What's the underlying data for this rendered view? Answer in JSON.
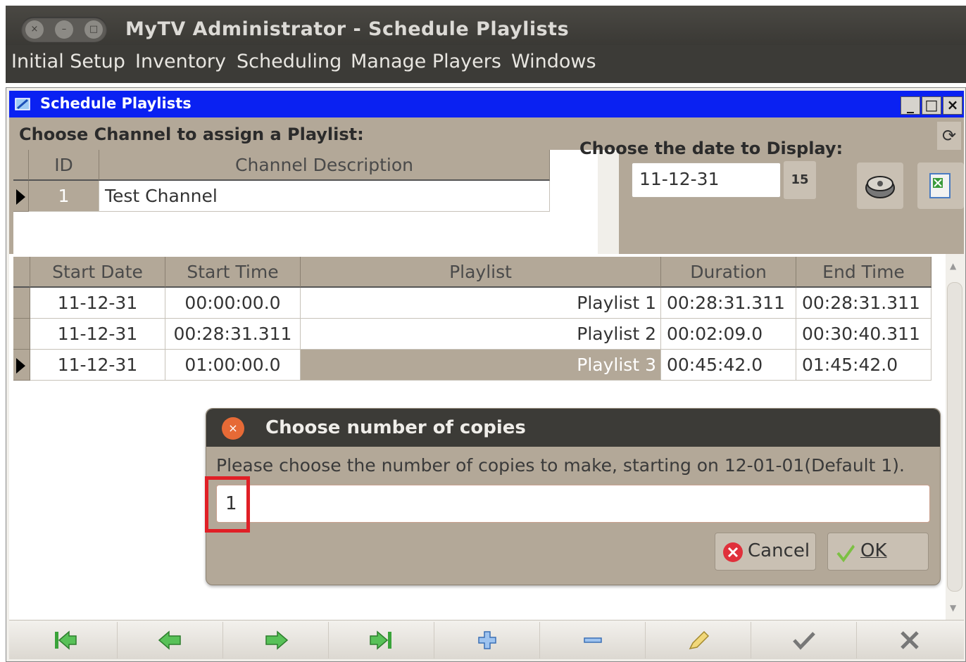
{
  "app": {
    "title": "MyTV Administrator - Schedule Playlists"
  },
  "menu": {
    "items": [
      "Initial Setup",
      "Inventory",
      "Scheduling",
      "Manage Players",
      "Windows"
    ]
  },
  "inner_window": {
    "title": "Schedule Playlists"
  },
  "channel_panel": {
    "label": "Choose Channel to assign a Playlist:",
    "columns": [
      "ID",
      "Channel Description"
    ],
    "rows": [
      {
        "id": "1",
        "description": "Test Channel"
      }
    ]
  },
  "date_panel": {
    "label": "Choose the date to Display:",
    "date_value": "11-12-31",
    "calendar_button_label": "15"
  },
  "schedule": {
    "columns": [
      "Start Date",
      "Start Time",
      "Playlist",
      "Duration",
      "End Time"
    ],
    "rows": [
      {
        "start_date": "11-12-31",
        "start_time": "00:00:00.0",
        "playlist": "Playlist 1",
        "duration": "00:28:31.311",
        "end_time": "00:28:31.311"
      },
      {
        "start_date": "11-12-31",
        "start_time": "00:28:31.311",
        "playlist": "Playlist 2",
        "duration": "00:02:09.0",
        "end_time": "00:30:40.311"
      },
      {
        "start_date": "11-12-31",
        "start_time": "01:00:00.0",
        "playlist": "Playlist 3",
        "duration": "00:45:42.0",
        "end_time": "01:45:42.0"
      }
    ]
  },
  "dialog": {
    "title": "Choose number of copies",
    "message": "Please choose the number of copies to make, starting on 12-01-01(Default 1).",
    "input_value": "1",
    "cancel_label": "Cancel",
    "ok_label": "OK"
  },
  "navigator": {
    "buttons": [
      "first-record",
      "previous-record",
      "next-record",
      "last-record",
      "insert-record",
      "delete-record",
      "edit-record",
      "post-record",
      "cancel-edit"
    ]
  }
}
